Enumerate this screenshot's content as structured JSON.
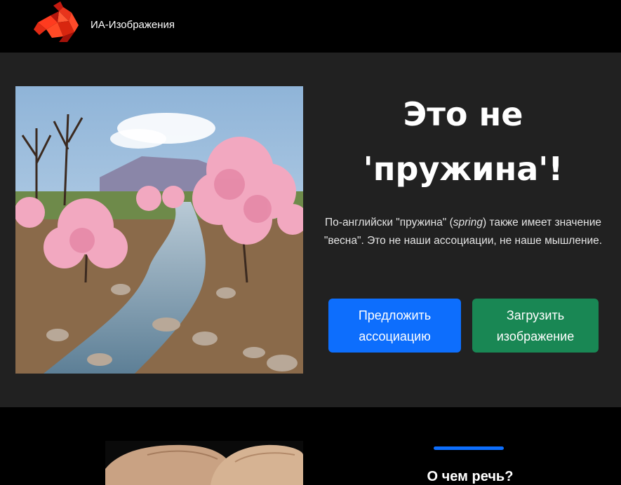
{
  "navbar": {
    "brand": "ИА-Изображения",
    "logo_icon": "red-low-poly-horse-logo"
  },
  "hero": {
    "image_icon": "blossoming-spring-trees-by-stream",
    "title_line1": "Это не",
    "title_line2": "'пружина'!",
    "desc_before": "По-английски \"пружина\" (",
    "desc_em": "spring",
    "desc_after": ") также имеет значение \"весна\". Это не наши ассоциации, не наше мышление.",
    "suggest_button": "Предложить ассоциацию",
    "upload_button": "Загрузить изображение"
  },
  "section2": {
    "image_icon": "fingers-close-up-photo",
    "heading": "О чем речь?"
  },
  "colors": {
    "primary": "#0d6efd",
    "success": "#198754",
    "hero_bg": "#212121",
    "page_bg": "#000000"
  }
}
